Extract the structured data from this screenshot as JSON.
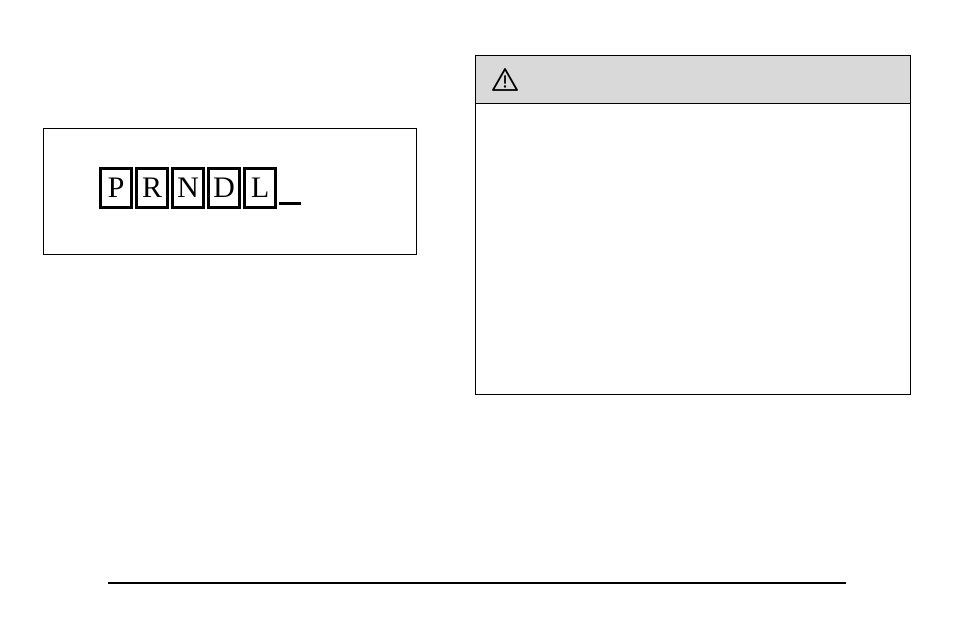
{
  "gear_indicator": {
    "letters": [
      "P",
      "R",
      "N",
      "D",
      "L"
    ]
  },
  "warning_box": {
    "icon": "warning-triangle-icon"
  }
}
